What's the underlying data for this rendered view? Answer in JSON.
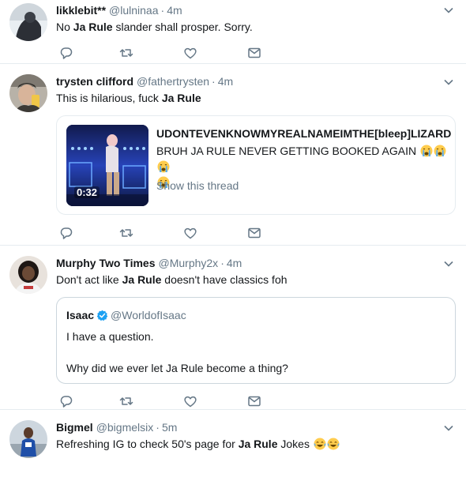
{
  "tweets": [
    {
      "name": "likklebit**",
      "handle": "@lulninaa",
      "sep": "·",
      "time": "4m",
      "text_pre": "No ",
      "text_bold": "Ja Rule",
      "text_post": " slander shall prosper. Sorry."
    },
    {
      "name": "trysten clifford",
      "handle": "@fathertrysten",
      "sep": "·",
      "time": "4m",
      "text_pre": "This is hilarious, fuck ",
      "text_bold": "Ja Rule",
      "text_post": "",
      "card": {
        "user": "UDONTEVENKNOWMYREALNAMEIMTHE[bleep]LIZARD",
        "text": "BRUH JA RULE NEVER GETTING BOOKED AGAIN",
        "emoji": "loudly-crying-face-emoji",
        "link": "Show this thread",
        "duration": "0:32"
      }
    },
    {
      "name": "Murphy Two Times",
      "handle": "@Murphy2x",
      "sep": "·",
      "time": "4m",
      "text_pre": "Don't act like ",
      "text_bold": "Ja Rule",
      "text_post": " doesn't have classics foh",
      "quote": {
        "name": "Isaac",
        "handle": "@WorldofIsaac",
        "line1": "I have a question.",
        "line2": "Why did we ever let Ja Rule become a thing?"
      }
    },
    {
      "name": "Bigmel",
      "handle": "@bigmelsix",
      "sep": "·",
      "time": "5m",
      "text_pre": "Refreshing IG to check 50's page for ",
      "text_bold": "Ja Rule",
      "text_post": " Jokes",
      "emoji": "face-with-tears-of-joy-emoji"
    }
  ],
  "icons": {
    "reply": "reply-icon",
    "retweet": "retweet-icon",
    "like": "heart-icon",
    "dm": "envelope-icon",
    "caret": "chevron-down-icon",
    "verified": "verified-badge-icon"
  },
  "colors": {
    "icon_gray": "#657786",
    "border": "#e6ecf0",
    "verified_blue": "#1da1f2"
  }
}
